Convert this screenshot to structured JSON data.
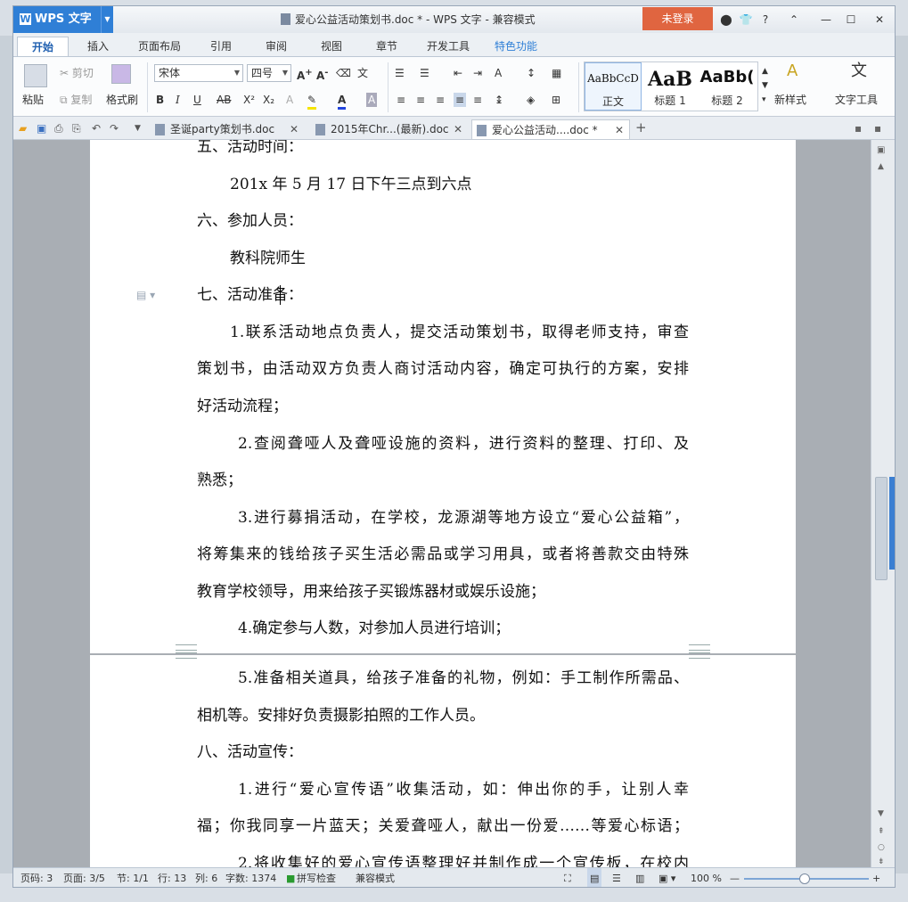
{
  "app": {
    "logo": "WPS 文字",
    "title": "爱心公益活动策划书.doc * - WPS 文字 - 兼容模式",
    "login": "未登录"
  },
  "window_controls": {
    "skin": "👕",
    "help": "?",
    "collapse": "⌃",
    "minimize": "—",
    "maximize": "☐",
    "close": "✕"
  },
  "ribbon_tabs": [
    "开始",
    "插入",
    "页面布局",
    "引用",
    "审阅",
    "视图",
    "章节",
    "开发工具",
    "特色功能"
  ],
  "ribbon": {
    "paste": "粘贴",
    "cut": "剪切",
    "copy": "复制",
    "format_painter": "格式刷",
    "font_name": "宋体",
    "font_size": "四号",
    "styles": [
      {
        "preview": "AaBbCcD",
        "label": "正文"
      },
      {
        "preview": "AaB",
        "label": "标题 1"
      },
      {
        "preview": "AaBb(",
        "label": "标题 2"
      }
    ],
    "new_style": "新样式",
    "text_tools": "文字工具"
  },
  "doc_tabs": [
    {
      "label": "圣诞party策划书.doc"
    },
    {
      "label": "2015年Chr...(最新).doc"
    },
    {
      "label": "爱心公益活动....doc *"
    }
  ],
  "document": {
    "page1": [
      "五、活动时间：",
      "201x 年 5 月 17 日下午三点到六点",
      "六、参加人员：",
      "教科院师生",
      "七、活动准备：",
      "1.联系活动地点负责人，提交活动策划书，取得老师支持，审查",
      "策划书，由活动双方负责人商讨活动内容，确定可执行的方案，安排",
      "好活动流程；",
      "2.查阅聋哑人及聋哑设施的资料，进行资料的整理、打印、及",
      "熟悉；",
      "3.进行募捐活动，在学校，龙源湖等地方设立“爱心公益箱”，",
      "将筹集来的钱给孩子买生活必需品或学习用具，或者将善款交由特殊",
      "教育学校领导，用来给孩子买锻炼器材或娱乐设施；",
      "4.确定参与人数，对参加人员进行培训；"
    ],
    "page2": [
      "5.准备相关道具，给孩子准备的礼物，例如：手工制作所需品、",
      "相机等。安排好负责摄影拍照的工作人员。",
      "八、活动宣传：",
      "1.进行“爱心宣传语”收集活动，如：伸出你的手，让别人幸",
      "福；你我同享一片蓝天；关爱聋哑人，献出一份爱……等爱心标语；",
      "2.将收集好的爱心宣传语整理好并制作成一个宣传板，在校内"
    ]
  },
  "status": {
    "page_code": "页码: 3",
    "pages": "页面: 3/5",
    "section": "节: 1/1",
    "row": "行: 13",
    "col": "列: 6",
    "word_count": "字数: 1374",
    "spell": "拼写检查",
    "compat": "兼容模式",
    "zoom": "100 %"
  },
  "colors": {
    "accent": "#2f7fd6",
    "login": "#e06540"
  }
}
